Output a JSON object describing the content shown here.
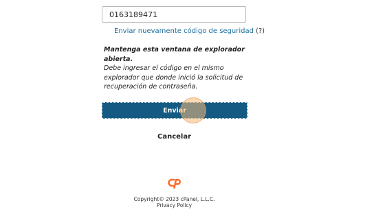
{
  "form": {
    "code_value": "0163189471",
    "resend_label": "Enviar nuevamente código de seguridad",
    "help_label": "(?)",
    "notice_title": "Mantenga esta ventana de explorador abierta.",
    "notice_body": "Debe ingresar el código en el mismo explorador que donde inició la solicitud de recuperación de contraseña.",
    "send_label": "Enviar",
    "cancel_label": "Cancelar"
  },
  "footer": {
    "copyright": "Copyright© 2023 cPanel, L.L.C.",
    "privacy": "Privacy Policy"
  },
  "colors": {
    "accent": "#155a82",
    "link": "#1a6e9e",
    "logo": "#ff6c2c"
  }
}
